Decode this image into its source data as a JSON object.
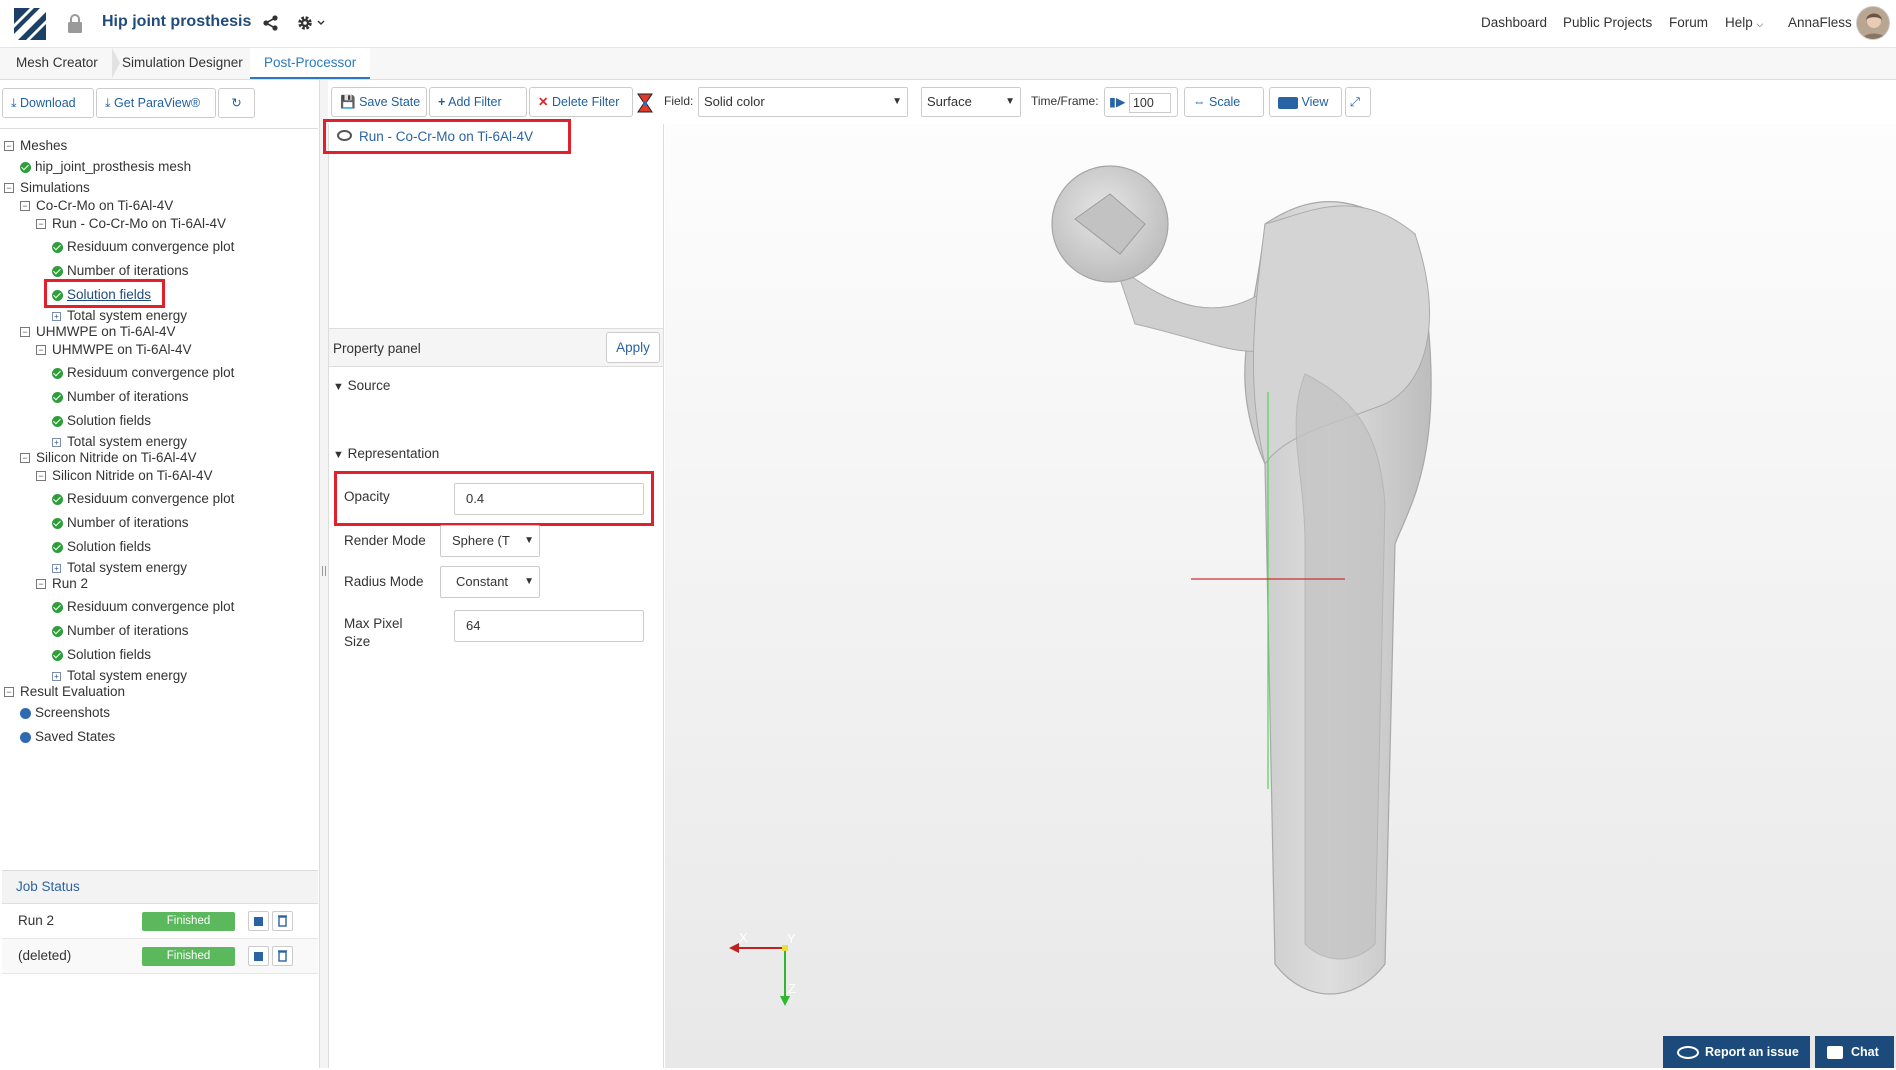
{
  "header": {
    "project_title": "Hip joint prosthesis",
    "nav": [
      "Dashboard",
      "Public Projects",
      "Forum",
      "Help",
      "AnnaFless"
    ]
  },
  "tabs": [
    "Mesh Creator",
    "Simulation Designer",
    "Post-Processor"
  ],
  "left_toolbar": {
    "download": "Download",
    "paraview": "Get ParaView®"
  },
  "tree": {
    "meshes": "Meshes",
    "mesh_item": "hip_joint_prosthesis mesh",
    "simulations": "Simulations",
    "sim1": "Co-Cr-Mo on Ti-6Al-4V",
    "sim1_run": "Run - Co-Cr-Mo on Ti-6Al-4V",
    "residuum": "Residuum convergence plot",
    "iterations": "Number of iterations",
    "solution": "Solution fields",
    "energy": "Total system energy",
    "sim2": "UHMWPE on Ti-6Al-4V",
    "sim2_run": "UHMWPE on Ti-6Al-4V",
    "sim3": "Silicon Nitride on Ti-6Al-4V",
    "sim3_run": "Silicon Nitride on Ti-6Al-4V",
    "sim3_run2": "Run 2",
    "result_eval": "Result Evaluation",
    "screenshots": "Screenshots",
    "saved_states": "Saved States"
  },
  "job_status": {
    "title": "Job Status",
    "rows": [
      {
        "name": "Run 2",
        "status": "Finished"
      },
      {
        "name": "(deleted)",
        "status": "Finished"
      }
    ]
  },
  "toolbar": {
    "save_state": "Save State",
    "add_filter": "Add Filter",
    "delete_filter": "Delete Filter",
    "field_label": "Field:",
    "field_value": "Solid color",
    "representation_value": "Surface",
    "time_label": "Time/Frame:",
    "time_value": "100",
    "scale": "Scale",
    "view": "View"
  },
  "pipeline": {
    "item": "Run - Co-Cr-Mo on Ti-6Al-4V"
  },
  "property_panel": {
    "title": "Property panel",
    "apply": "Apply",
    "source": "Source",
    "representation": "Representation",
    "opacity_label": "Opacity",
    "opacity_value": "0.4",
    "render_mode_label": "Render Mode",
    "render_mode_value": "Sphere (T",
    "radius_mode_label": "Radius Mode",
    "radius_mode_value": "Constant",
    "max_pixel_label_1": "Max Pixel",
    "max_pixel_label_2": "Size",
    "max_pixel_value": "64"
  },
  "viewport": {
    "axis_x": "X",
    "axis_y": "Y",
    "axis_z": "Z"
  },
  "footer": {
    "report": "Report an issue",
    "chat": "Chat"
  },
  "colors": {
    "accent": "#2b78c2",
    "highlight_box": "#e0202a",
    "finished_badge": "#5cb85c"
  }
}
